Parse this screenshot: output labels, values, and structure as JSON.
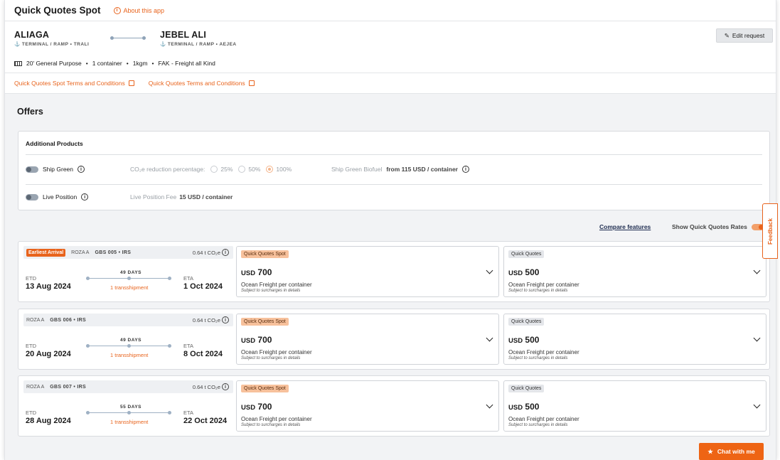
{
  "header": {
    "title": "Quick Quotes Spot",
    "about_label": "About this app"
  },
  "route": {
    "origin": {
      "name": "ALIAGA",
      "sub": "TERMINAL / RAMP • TRALI"
    },
    "destination": {
      "name": "JEBEL ALI",
      "sub": "TERMINAL / RAMP • AEJEA"
    },
    "edit_label": "Edit request"
  },
  "cargo": {
    "container_type": "20' General Purpose",
    "count": "1 container",
    "weight": "1kgm",
    "commodity": "FAK - Freight all Kind"
  },
  "terms": {
    "spot_link": "Quick Quotes Spot Terms and Conditions",
    "std_link": "Quick Quotes Terms and Conditions"
  },
  "offers_title": "Offers",
  "additional": {
    "title": "Additional Products",
    "ship_green_label": "Ship Green",
    "co2_reduction_label": "CO₂e reduction percentage:",
    "options": [
      "25%",
      "50%",
      "100%"
    ],
    "biofuel_label": "Ship Green Biofuel",
    "biofuel_price": "from 115 USD / container",
    "live_position_label": "Live Position",
    "live_fee_label": "Live Position Fee",
    "live_fee_price": "15 USD / container"
  },
  "controls": {
    "compare_label": "Compare features",
    "show_rates_label": "Show Quick Quotes Rates"
  },
  "feedback_label": "Feedback",
  "offers": [
    {
      "badge": "Earliest Arrival",
      "vessel": "ROZA A",
      "service": "GBS 005 • IRS",
      "co2": "0.64 t CO₂e",
      "etd_label": "ETD",
      "etd": "13 Aug 2024",
      "eta_label": "ETA",
      "eta": "1 Oct 2024",
      "days": "49 DAYS",
      "transship": "1 transshipment",
      "spot": {
        "label": "Quick Quotes Spot",
        "currency": "USD",
        "amount": "700",
        "desc": "Ocean Freight per container",
        "note": "Subject to surcharges in details"
      },
      "std": {
        "label": "Quick Quotes",
        "currency": "USD",
        "amount": "500",
        "desc": "Ocean Freight per container",
        "note": "Subject to surcharges in details"
      }
    },
    {
      "badge": "",
      "vessel": "ROZA A",
      "service": "GBS 006 • IRS",
      "co2": "0.64 t CO₂e",
      "etd_label": "ETD",
      "etd": "20 Aug 2024",
      "eta_label": "ETA",
      "eta": "8 Oct 2024",
      "days": "49 DAYS",
      "transship": "1 transshipment",
      "spot": {
        "label": "Quick Quotes Spot",
        "currency": "USD",
        "amount": "700",
        "desc": "Ocean Freight per container",
        "note": "Subject to surcharges in details"
      },
      "std": {
        "label": "Quick Quotes",
        "currency": "USD",
        "amount": "500",
        "desc": "Ocean Freight per container",
        "note": "Subject to surcharges in details"
      }
    },
    {
      "badge": "",
      "vessel": "ROZA A",
      "service": "GBS 007 • IRS",
      "co2": "0.64 t CO₂e",
      "etd_label": "ETD",
      "etd": "28 Aug 2024",
      "eta_label": "ETA",
      "eta": "22 Oct 2024",
      "days": "55 DAYS",
      "transship": "1 transshipment",
      "spot": {
        "label": "Quick Quotes Spot",
        "currency": "USD",
        "amount": "700",
        "desc": "Ocean Freight per container",
        "note": "Subject to surcharges in details"
      },
      "std": {
        "label": "Quick Quotes",
        "currency": "USD",
        "amount": "500",
        "desc": "Ocean Freight per container",
        "note": "Subject to surcharges in details"
      }
    }
  ],
  "chat_label": "Chat with me",
  "colors": {
    "accent": "#e8631c",
    "spot_badge": "#f7c19c",
    "background": "#f2f3f5"
  }
}
